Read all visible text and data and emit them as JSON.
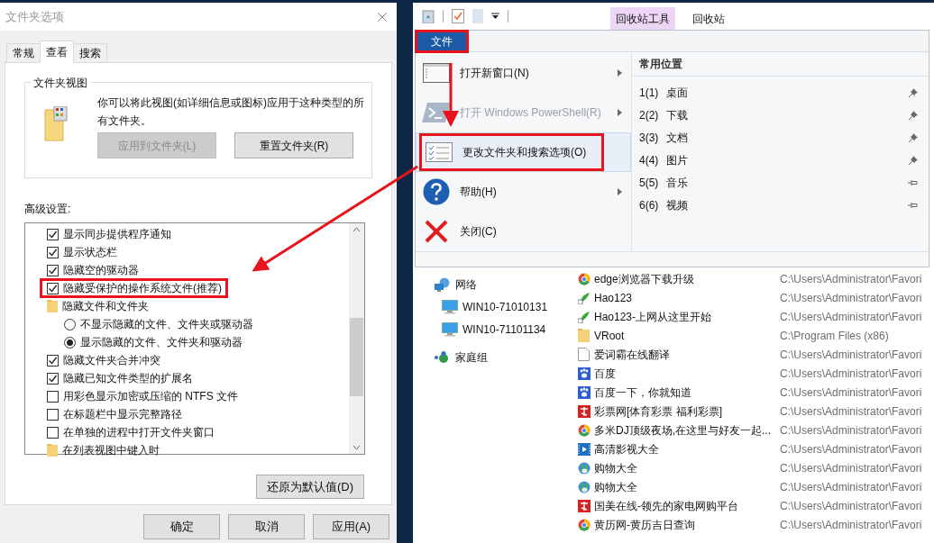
{
  "folder_options": {
    "title": "文件夹选项",
    "tabs": [
      {
        "label": "常规",
        "selected": false
      },
      {
        "label": "查看",
        "selected": true
      },
      {
        "label": "搜索",
        "selected": false
      }
    ],
    "folder_views": {
      "title": "文件夹视图",
      "description": "你可以将此视图(如详细信息或图标)应用于这种类型的所有文件夹。",
      "buttons": [
        {
          "label": "应用到文件夹(L)",
          "disabled": true
        },
        {
          "label": "重置文件夹(R)",
          "disabled": false
        }
      ]
    },
    "advanced_label": "高级设置:",
    "settings": [
      {
        "kind": "checkbox",
        "label": "显示同步提供程序通知",
        "checked": true,
        "highlighted": false
      },
      {
        "kind": "checkbox",
        "label": "显示状态栏",
        "checked": true,
        "highlighted": false
      },
      {
        "kind": "checkbox",
        "label": "隐藏空的驱动器",
        "checked": true,
        "highlighted": false
      },
      {
        "kind": "checkbox",
        "label": "隐藏受保护的操作系统文件(推荐)",
        "checked": true,
        "highlighted": true
      },
      {
        "kind": "folder",
        "label": "隐藏文件和文件夹",
        "children": [
          {
            "kind": "radio",
            "label": "不显示隐藏的文件、文件夹或驱动器",
            "selected": false
          },
          {
            "kind": "radio",
            "label": "显示隐藏的文件、文件夹和驱动器",
            "selected": true
          }
        ]
      },
      {
        "kind": "checkbox",
        "label": "隐藏文件夹合并冲突",
        "checked": true,
        "highlighted": false
      },
      {
        "kind": "checkbox",
        "label": "隐藏已知文件类型的扩展名",
        "checked": true,
        "highlighted": false
      },
      {
        "kind": "checkbox",
        "label": "用彩色显示加密或压缩的 NTFS 文件",
        "checked": false,
        "highlighted": false
      },
      {
        "kind": "checkbox",
        "label": "在标题栏中显示完整路径",
        "checked": false,
        "highlighted": false
      },
      {
        "kind": "checkbox",
        "label": "在单独的进程中打开文件夹窗口",
        "checked": false,
        "highlighted": false
      },
      {
        "kind": "folder",
        "label": "在列表视图中键入时"
      }
    ],
    "restore_button": "还原为默认值(D)",
    "footer_buttons": [
      "确定",
      "取消",
      "应用(A)"
    ]
  },
  "explorer": {
    "ribbon_tabs": [
      {
        "label": "回收站工具",
        "contextual": true
      },
      {
        "label": "回收站",
        "contextual": false
      }
    ],
    "file_tab": {
      "label": "文件",
      "highlighted": true
    },
    "file_menu": [
      {
        "kind": "window",
        "label": "打开新窗口(N)",
        "submenu": true,
        "disabled": false,
        "highlighted": false
      },
      {
        "kind": "powershell",
        "label": "打开 Windows PowerShell(R)",
        "submenu": true,
        "disabled": true,
        "highlighted": false
      },
      {
        "kind": "options",
        "label": "更改文件夹和搜索选项(O)",
        "submenu": false,
        "disabled": false,
        "highlighted": true
      },
      {
        "kind": "help",
        "label": "帮助(H)",
        "submenu": true,
        "disabled": false,
        "highlighted": false
      },
      {
        "kind": "close",
        "label": "关闭(C)",
        "submenu": false,
        "disabled": false,
        "highlighted": false
      }
    ],
    "frequent_title": "常用位置",
    "frequent_places": [
      {
        "number": "1(1)",
        "name": "桌面",
        "pinned": true
      },
      {
        "number": "2(2)",
        "name": "下载",
        "pinned": true
      },
      {
        "number": "3(3)",
        "name": "文档",
        "pinned": true
      },
      {
        "number": "4(4)",
        "name": "图片",
        "pinned": true
      },
      {
        "number": "5(5)",
        "name": "音乐",
        "pinned": false
      },
      {
        "number": "6(6)",
        "name": "视频",
        "pinned": false
      }
    ],
    "navigation": [
      {
        "kind": "network",
        "label": "网络",
        "children": [
          {
            "kind": "computer",
            "label": "WIN10-71010131"
          },
          {
            "kind": "computer",
            "label": "WIN10-71101134"
          }
        ]
      },
      {
        "kind": "homegroup",
        "label": "家庭组"
      }
    ],
    "files": [
      {
        "kind": "browser",
        "name": "edge浏览器下载升级",
        "path": "C:\\Users\\Administrator\\Favori"
      },
      {
        "kind": "leaf",
        "name": "Hao123",
        "path": "C:\\Users\\Administrator\\Favori"
      },
      {
        "kind": "leaf",
        "name": "Hao123-上网从这里开始",
        "path": "C:\\Users\\Administrator\\Favori"
      },
      {
        "kind": "folder",
        "name": "VRoot",
        "path": "C:\\Program Files (x86)"
      },
      {
        "kind": "page",
        "name": "爱词霸在线翻译",
        "path": "C:\\Users\\Administrator\\Favori"
      },
      {
        "kind": "paw",
        "name": "百度",
        "path": "C:\\Users\\Administrator\\Favori"
      },
      {
        "kind": "paw",
        "name": "百度一下，你就知道",
        "path": "C:\\Users\\Administrator\\Favori"
      },
      {
        "kind": "tile",
        "name": "彩票网[体育彩票 福利彩票]",
        "path": "C:\\Users\\Administrator\\Favori"
      },
      {
        "kind": "browser",
        "name": "多米DJ顶级夜场,在这里与好友一起...",
        "path": "C:\\Users\\Administrator\\Favori"
      },
      {
        "kind": "film",
        "name": "高清影视大全",
        "path": "C:\\Users\\Administrator\\Favori"
      },
      {
        "kind": "globe",
        "name": "购物大全",
        "path": "C:\\Users\\Administrator\\Favori"
      },
      {
        "kind": "globe",
        "name": "购物大全",
        "path": "C:\\Users\\Administrator\\Favori"
      },
      {
        "kind": "tile",
        "name": "国美在线-领先的家电网购平台",
        "path": "C:\\Users\\Administrator\\Favori"
      },
      {
        "kind": "browser",
        "name": "黄历网-黄历吉日查询",
        "path": "C:\\Users\\Administrator\\Favori"
      }
    ]
  }
}
